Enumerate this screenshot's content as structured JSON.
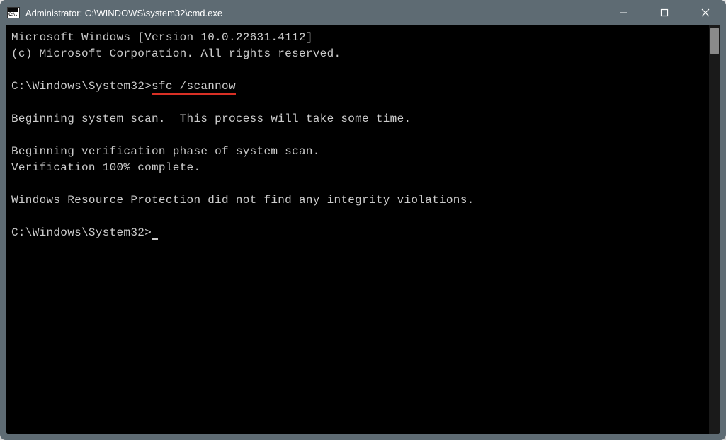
{
  "titlebar": {
    "icon_label": "C:\\.",
    "title": "Administrator: C:\\WINDOWS\\system32\\cmd.exe"
  },
  "terminal": {
    "line1": "Microsoft Windows [Version 10.0.22631.4112]",
    "line2": "(c) Microsoft Corporation. All rights reserved.",
    "blank1": "",
    "prompt1_path": "C:\\Windows\\System32>",
    "prompt1_command": "sfc /scannow",
    "blank2": "",
    "line3": "Beginning system scan.  This process will take some time.",
    "blank3": "",
    "line4": "Beginning verification phase of system scan.",
    "line5": "Verification 100% complete.",
    "blank4": "",
    "line6": "Windows Resource Protection did not find any integrity violations.",
    "blank5": "",
    "prompt2_path": "C:\\Windows\\System32>"
  }
}
